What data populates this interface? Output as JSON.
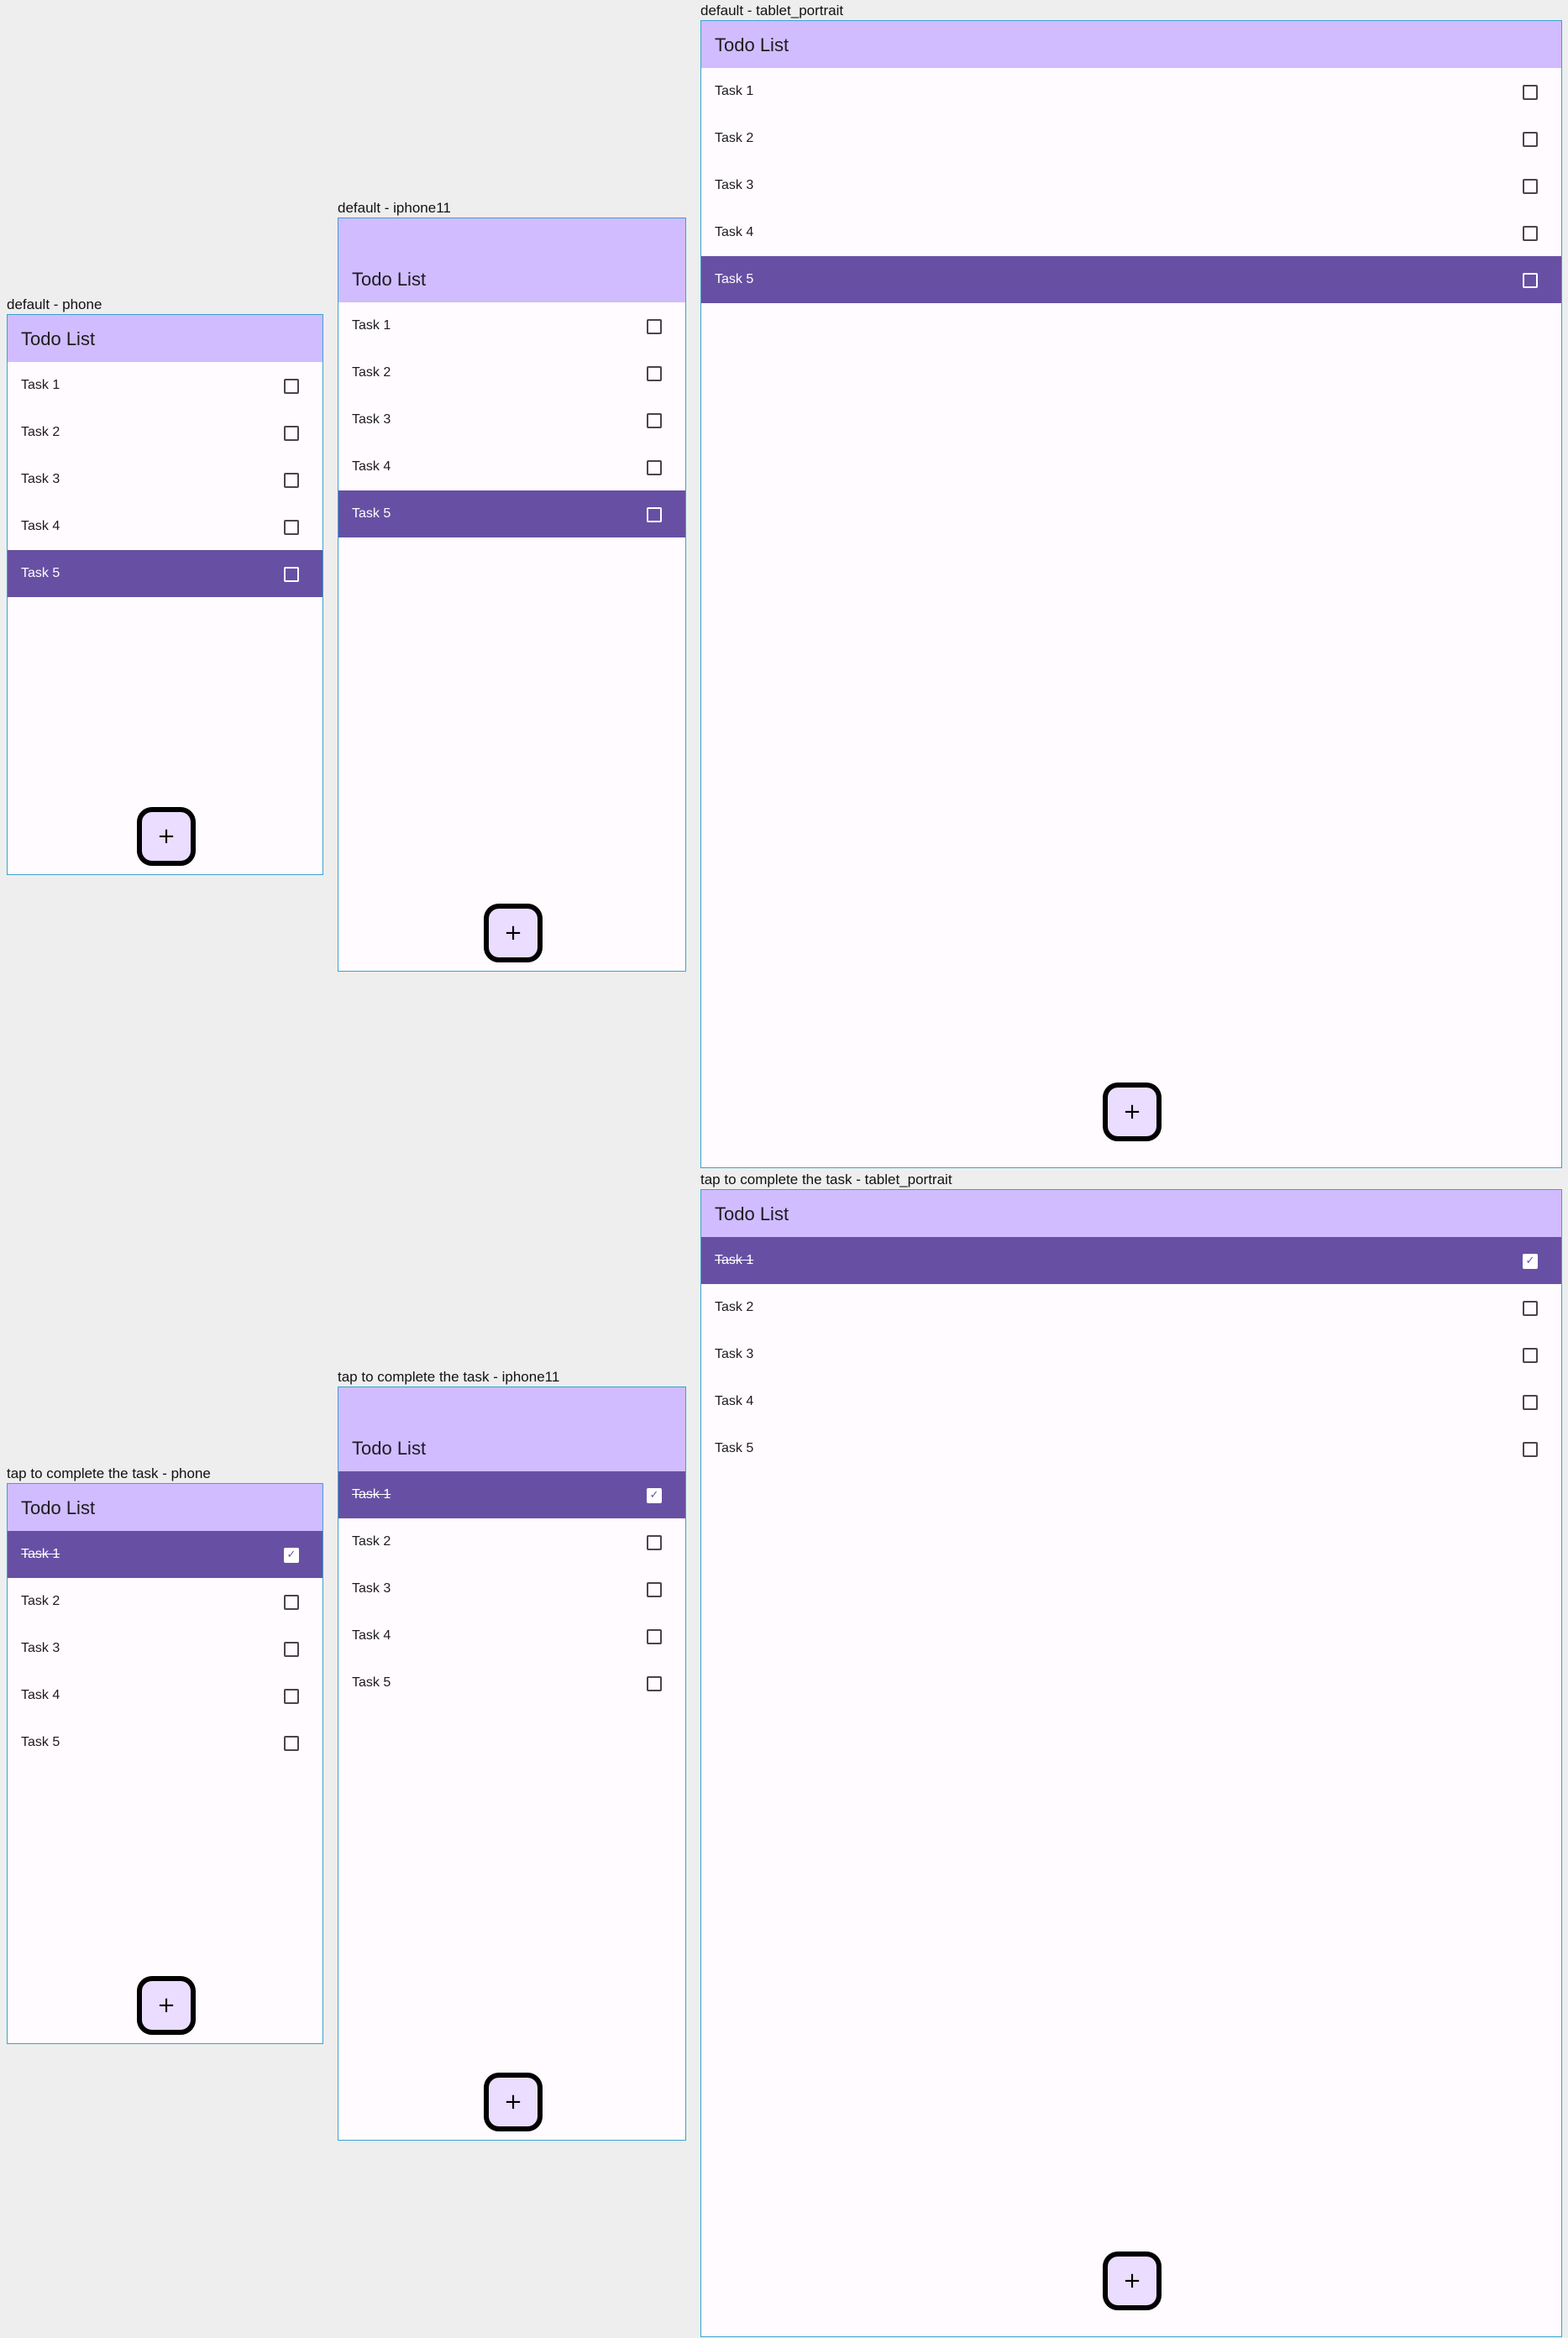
{
  "app_title": "Todo List",
  "fab_icon": "+",
  "check_glyph": "✓",
  "colors": {
    "background": "#eeeeee",
    "appbar": "#d0bcff",
    "selected_row": "#6750a4",
    "surface": "#fffbfe",
    "fab": "#eaddff",
    "frame_border": "#3aa3d0"
  },
  "frames": [
    {
      "label": "default - phone",
      "tasks": [
        {
          "label": "Task 1",
          "checked": false,
          "selected": false
        },
        {
          "label": "Task 2",
          "checked": false,
          "selected": false
        },
        {
          "label": "Task 3",
          "checked": false,
          "selected": false
        },
        {
          "label": "Task 4",
          "checked": false,
          "selected": false
        },
        {
          "label": "Task 5",
          "checked": false,
          "selected": true
        }
      ]
    },
    {
      "label": "default - iphone11",
      "tasks": [
        {
          "label": "Task 1",
          "checked": false,
          "selected": false
        },
        {
          "label": "Task 2",
          "checked": false,
          "selected": false
        },
        {
          "label": "Task 3",
          "checked": false,
          "selected": false
        },
        {
          "label": "Task 4",
          "checked": false,
          "selected": false
        },
        {
          "label": "Task 5",
          "checked": false,
          "selected": true
        }
      ]
    },
    {
      "label": "default - tablet_portrait",
      "tasks": [
        {
          "label": "Task 1",
          "checked": false,
          "selected": false
        },
        {
          "label": "Task 2",
          "checked": false,
          "selected": false
        },
        {
          "label": "Task 3",
          "checked": false,
          "selected": false
        },
        {
          "label": "Task 4",
          "checked": false,
          "selected": false
        },
        {
          "label": "Task 5",
          "checked": false,
          "selected": true
        }
      ]
    },
    {
      "label": "tap to complete the task - phone",
      "tasks": [
        {
          "label": "Task 1",
          "checked": true,
          "selected": true
        },
        {
          "label": "Task 2",
          "checked": false,
          "selected": false
        },
        {
          "label": "Task 3",
          "checked": false,
          "selected": false
        },
        {
          "label": "Task 4",
          "checked": false,
          "selected": false
        },
        {
          "label": "Task 5",
          "checked": false,
          "selected": false
        }
      ]
    },
    {
      "label": "tap to complete the task - iphone11",
      "tasks": [
        {
          "label": "Task 1",
          "checked": true,
          "selected": true
        },
        {
          "label": "Task 2",
          "checked": false,
          "selected": false
        },
        {
          "label": "Task 3",
          "checked": false,
          "selected": false
        },
        {
          "label": "Task 4",
          "checked": false,
          "selected": false
        },
        {
          "label": "Task 5",
          "checked": false,
          "selected": false
        }
      ]
    },
    {
      "label": "tap to complete the task - tablet_portrait",
      "tasks": [
        {
          "label": "Task 1",
          "checked": true,
          "selected": true
        },
        {
          "label": "Task 2",
          "checked": false,
          "selected": false
        },
        {
          "label": "Task 3",
          "checked": false,
          "selected": false
        },
        {
          "label": "Task 4",
          "checked": false,
          "selected": false
        },
        {
          "label": "Task 5",
          "checked": false,
          "selected": false
        }
      ]
    }
  ]
}
